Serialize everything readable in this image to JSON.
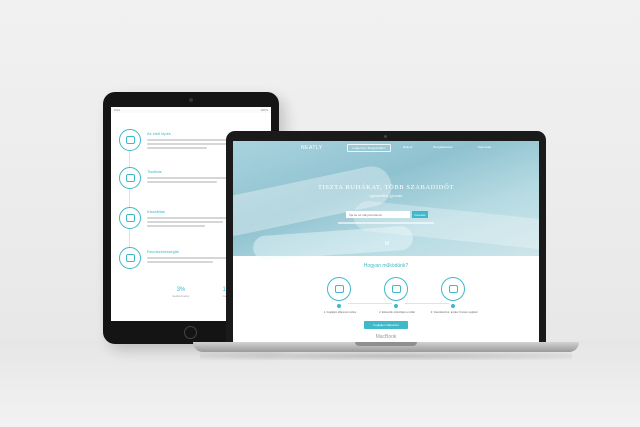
{
  "tablet": {
    "status_left": "iPad",
    "status_right": "100%",
    "steps": [
      {
        "title": "Az első lépés"
      },
      {
        "title": "Tisztítás"
      },
      {
        "title": "Kiszállítás"
      },
      {
        "title": "Rendszerességük"
      }
    ],
    "stats": [
      {
        "value": "3%",
        "caption": "kedvezmény"
      },
      {
        "value": "10.4%",
        "caption": "megtakarítás"
      }
    ]
  },
  "laptop": {
    "logo": "NEATLY",
    "nav_button": "Lépjen be / Regisztráljon",
    "nav_links": [
      "Rólunk",
      "Szolgáltatások",
      "Kapcsolat"
    ],
    "headline": "TISZTA RUHÁKAT, TÖBB SZABADIDŐT",
    "subline": "egyszerűen, gyorsan",
    "search_placeholder": "Írja be az irányítószámát",
    "search_button": "Keresés",
    "scroll_icon": "M",
    "how_title": "Hogyan működünk?",
    "steps": [
      {
        "caption": "1. Foglaljon időpontot online"
      },
      {
        "caption": "2. Elvisszük, kitisztítjuk a ruháit"
      },
      {
        "caption": "3. Visszahozzuk, amikor Önnek megfelel"
      }
    ],
    "cta_button": "Foglaljon időpontot",
    "brand": "MacBook"
  },
  "colors": {
    "accent": "#3fb8c9",
    "hero": "#8fc2d0"
  }
}
